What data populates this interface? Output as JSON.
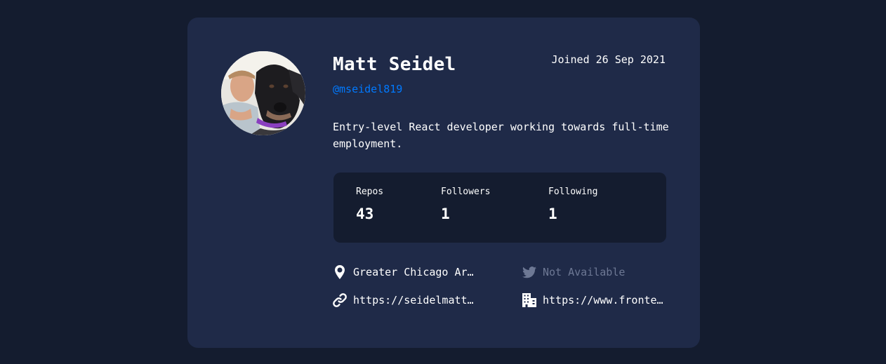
{
  "profile": {
    "name": "Matt Seidel",
    "handle": "@mseidel819",
    "joined": "Joined 26 Sep 2021",
    "bio": "Entry-level React developer working towards full-time employment."
  },
  "stats": {
    "repos_label": "Repos",
    "repos_value": "43",
    "followers_label": "Followers",
    "followers_value": "1",
    "following_label": "Following",
    "following_value": "1"
  },
  "links": {
    "location": "Greater Chicago Ar…",
    "twitter": "Not Available",
    "website": "https://seidelmatt…",
    "company": "https://www.fronte…"
  },
  "icons": {
    "avatar": "avatar-photo",
    "location": "location-pin-icon",
    "twitter": "twitter-icon",
    "website": "link-icon",
    "company": "building-icon"
  },
  "colors": {
    "page_bg": "#141c2f",
    "card_bg": "#1f2a48",
    "accent": "#0079ff",
    "muted": "#6d7894",
    "text": "#ffffff"
  }
}
